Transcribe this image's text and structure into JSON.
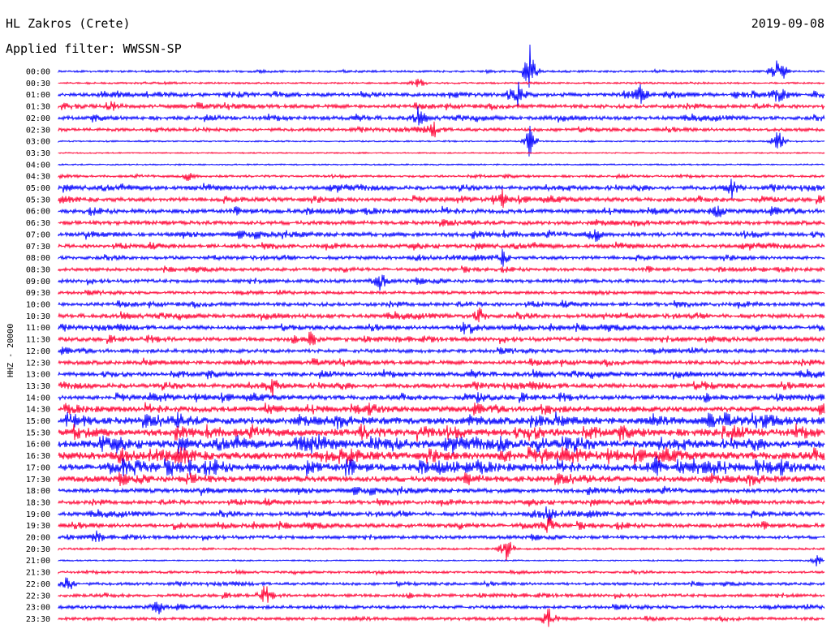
{
  "header": {
    "station": "HL Zakros (Crete)",
    "date": "2019-09-08",
    "filter": "Applied filter: WWSSN-SP"
  },
  "chart_data": {
    "type": "line",
    "subtype": "helicorder",
    "ylabel": "HHZ - 20000",
    "colors": [
      "#0000ff",
      "#ff0033"
    ],
    "rows": [
      {
        "label": "00:00",
        "activity": 0.2,
        "events": [
          {
            "t": 0.615,
            "amp": 2.6
          },
          {
            "t": 0.94,
            "amp": 2.4
          }
        ]
      },
      {
        "label": "00:30",
        "activity": 0.12,
        "events": [
          {
            "t": 0.47,
            "amp": 0.6
          }
        ]
      },
      {
        "label": "01:00",
        "activity": 0.55,
        "events": [
          {
            "t": 0.6,
            "amp": 1.2
          },
          {
            "t": 0.76,
            "amp": 1.0
          },
          {
            "t": 0.94,
            "amp": 0.9
          }
        ]
      },
      {
        "label": "01:30",
        "activity": 0.55,
        "events": [
          {
            "t": 0.07,
            "amp": 0.8
          }
        ]
      },
      {
        "label": "02:00",
        "activity": 0.55,
        "events": [
          {
            "t": 0.47,
            "amp": 0.8
          }
        ]
      },
      {
        "label": "02:30",
        "activity": 0.45,
        "events": [
          {
            "t": 0.49,
            "amp": 0.7
          }
        ]
      },
      {
        "label": "03:00",
        "activity": 0.05,
        "events": [
          {
            "t": 0.615,
            "amp": 1.6
          },
          {
            "t": 0.94,
            "amp": 1.2
          }
        ]
      },
      {
        "label": "03:30",
        "activity": 0.03,
        "events": []
      },
      {
        "label": "04:00",
        "activity": 0.06,
        "events": []
      },
      {
        "label": "04:30",
        "activity": 0.25,
        "events": [
          {
            "t": 0.17,
            "amp": 0.5
          }
        ]
      },
      {
        "label": "05:00",
        "activity": 0.6,
        "events": [
          {
            "t": 0.88,
            "amp": 1.0
          }
        ]
      },
      {
        "label": "05:30",
        "activity": 0.6,
        "events": [
          {
            "t": 0.58,
            "amp": 0.8
          }
        ]
      },
      {
        "label": "06:00",
        "activity": 0.65,
        "events": [
          {
            "t": 0.86,
            "amp": 0.9
          }
        ]
      },
      {
        "label": "06:30",
        "activity": 0.6,
        "events": []
      },
      {
        "label": "07:00",
        "activity": 0.65,
        "events": [
          {
            "t": 0.7,
            "amp": 0.9
          }
        ]
      },
      {
        "label": "07:30",
        "activity": 0.55,
        "events": []
      },
      {
        "label": "08:00",
        "activity": 0.5,
        "events": [
          {
            "t": 0.58,
            "amp": 0.7
          }
        ]
      },
      {
        "label": "08:30",
        "activity": 0.45,
        "events": []
      },
      {
        "label": "09:00",
        "activity": 0.5,
        "events": [
          {
            "t": 0.42,
            "amp": 1.0
          }
        ]
      },
      {
        "label": "09:30",
        "activity": 0.4,
        "events": []
      },
      {
        "label": "10:00",
        "activity": 0.55,
        "events": []
      },
      {
        "label": "10:30",
        "activity": 0.6,
        "events": [
          {
            "t": 0.55,
            "amp": 0.8
          }
        ]
      },
      {
        "label": "11:00",
        "activity": 0.6,
        "events": [
          {
            "t": 0.53,
            "amp": 0.9
          }
        ]
      },
      {
        "label": "11:30",
        "activity": 0.6,
        "events": [
          {
            "t": 0.33,
            "amp": 0.8
          }
        ]
      },
      {
        "label": "12:00",
        "activity": 0.55,
        "events": []
      },
      {
        "label": "12:30",
        "activity": 0.6,
        "events": []
      },
      {
        "label": "13:00",
        "activity": 0.65,
        "events": []
      },
      {
        "label": "13:30",
        "activity": 0.7,
        "events": [
          {
            "t": 0.28,
            "amp": 0.8
          }
        ]
      },
      {
        "label": "14:00",
        "activity": 0.7,
        "events": []
      },
      {
        "label": "14:30",
        "activity": 0.9,
        "events": []
      },
      {
        "label": "15:00",
        "activity": 1.2,
        "events": []
      },
      {
        "label": "15:30",
        "activity": 1.25,
        "events": []
      },
      {
        "label": "16:00",
        "activity": 1.3,
        "events": []
      },
      {
        "label": "16:30",
        "activity": 1.3,
        "events": []
      },
      {
        "label": "17:00",
        "activity": 1.2,
        "events": [
          {
            "t": 0.78,
            "amp": 1.1
          }
        ]
      },
      {
        "label": "17:30",
        "activity": 1.0,
        "events": []
      },
      {
        "label": "18:00",
        "activity": 0.65,
        "events": []
      },
      {
        "label": "18:30",
        "activity": 0.55,
        "events": []
      },
      {
        "label": "19:00",
        "activity": 0.6,
        "events": [
          {
            "t": 0.64,
            "amp": 0.9
          }
        ]
      },
      {
        "label": "19:30",
        "activity": 0.6,
        "events": [
          {
            "t": 0.64,
            "amp": 0.9
          }
        ]
      },
      {
        "label": "20:00",
        "activity": 0.45,
        "events": [
          {
            "t": 0.05,
            "amp": 0.6
          }
        ]
      },
      {
        "label": "20:30",
        "activity": 0.2,
        "events": [
          {
            "t": 0.585,
            "amp": 1.5
          }
        ]
      },
      {
        "label": "21:00",
        "activity": 0.05,
        "events": [
          {
            "t": 0.99,
            "amp": 0.6
          }
        ]
      },
      {
        "label": "21:30",
        "activity": 0.25,
        "events": []
      },
      {
        "label": "22:00",
        "activity": 0.35,
        "events": [
          {
            "t": 0.01,
            "amp": 1.4
          }
        ]
      },
      {
        "label": "22:30",
        "activity": 0.4,
        "events": [
          {
            "t": 0.27,
            "amp": 0.9
          }
        ]
      },
      {
        "label": "23:00",
        "activity": 0.45,
        "events": [
          {
            "t": 0.13,
            "amp": 0.7
          }
        ]
      },
      {
        "label": "23:30",
        "activity": 0.4,
        "events": [
          {
            "t": 0.64,
            "amp": 1.2
          }
        ]
      }
    ]
  }
}
